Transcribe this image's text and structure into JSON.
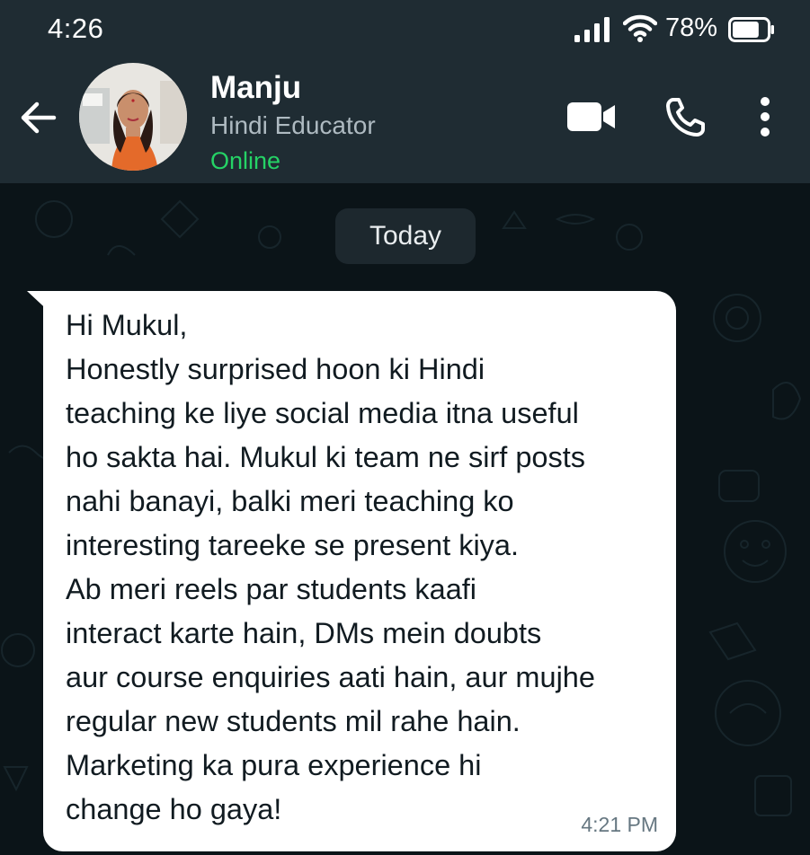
{
  "status_bar": {
    "time": "4:26",
    "battery_percent": "78%",
    "icons": [
      "signal-icon",
      "wifi-icon",
      "battery-icon"
    ],
    "battery_level": 0.78
  },
  "header": {
    "contact_name": "Manju",
    "contact_subtitle": "Hindi Educator",
    "contact_status": "Online",
    "icons": [
      "back-arrow-icon",
      "video-call-icon",
      "phone-icon",
      "more-vertical-icon"
    ],
    "colors": {
      "background": "#1f2c33",
      "online": "#25d366"
    }
  },
  "chat": {
    "date_label": "Today",
    "messages": [
      {
        "direction": "incoming",
        "text": "Hi Mukul,\nHonestly surprised hoon ki Hindi\nteaching ke liye social media itna useful\nho sakta hai. Mukul ki team ne sirf posts\nnahi banayi, balki meri teaching ko\ninteresting tareeke se present kiya.\nAb meri reels par students kaafi\ninteract karte hain, DMs mein doubts\naur course enquiries aati hain, aur mujhe\nregular new students mil rahe hain.\nMarketing ka pura experience hi\nchange ho gaya!",
        "time": "4:21 PM"
      }
    ],
    "colors": {
      "background": "#0b1418",
      "bubble": "#ffffff",
      "bubble_text": "#111b21",
      "timestamp": "#667781"
    }
  }
}
